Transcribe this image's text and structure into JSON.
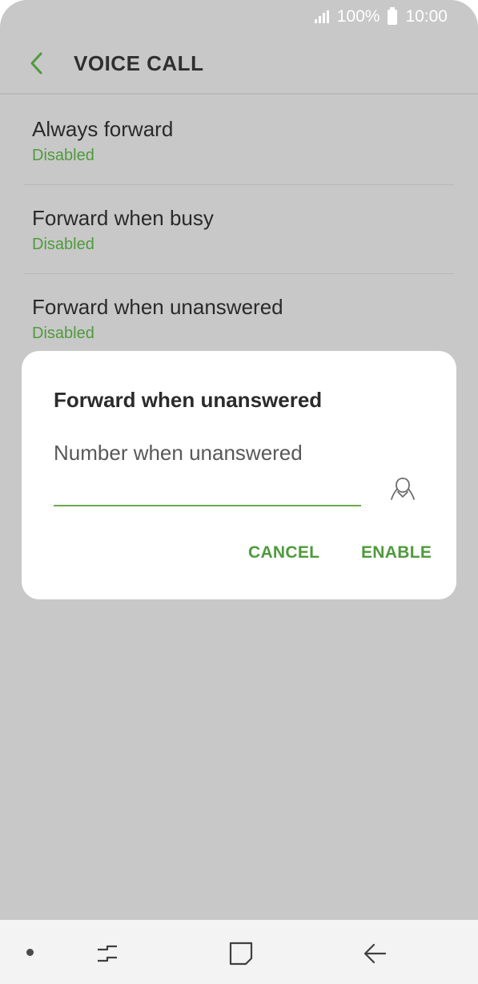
{
  "status_bar": {
    "battery": "100%",
    "time": "10:00"
  },
  "app_bar": {
    "title": "VOICE CALL"
  },
  "list": {
    "items": [
      {
        "title": "Always forward",
        "status": "Disabled"
      },
      {
        "title": "Forward when busy",
        "status": "Disabled"
      },
      {
        "title": "Forward when unanswered",
        "status": "Disabled"
      }
    ]
  },
  "dialog": {
    "title": "Forward when unanswered",
    "label": "Number when unanswered",
    "input_value": "",
    "cancel_label": "CANCEL",
    "enable_label": "ENABLE"
  },
  "colors": {
    "accent": "#4f9a3d",
    "scrim": "#c8c8c8"
  },
  "icons": [
    "back-arrow-icon",
    "contact-icon",
    "recent-apps-icon",
    "home-icon",
    "back-icon"
  ]
}
